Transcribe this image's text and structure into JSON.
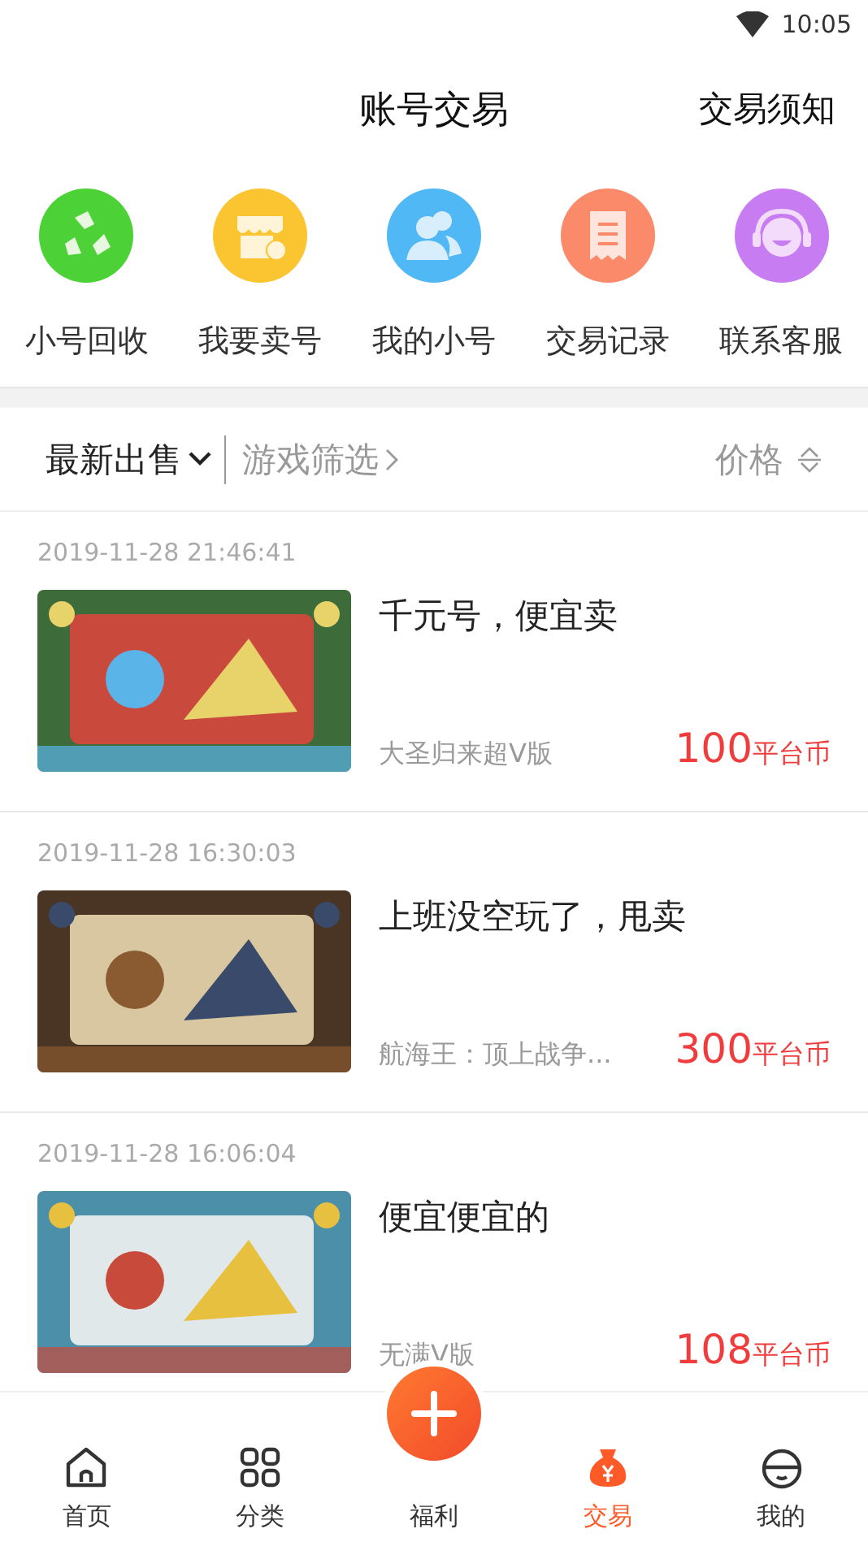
{
  "status_bar": {
    "time": "10:05"
  },
  "header": {
    "title": "账号交易",
    "action": "交易须知"
  },
  "shortcuts": [
    {
      "label": "小号回收",
      "kind": "recycle",
      "color": "#4cd137"
    },
    {
      "label": "我要卖号",
      "kind": "shop",
      "color": "#fbc531"
    },
    {
      "label": "我的小号",
      "kind": "users",
      "color": "#4fb8f5"
    },
    {
      "label": "交易记录",
      "kind": "receipt",
      "color": "#fb8a6a"
    },
    {
      "label": "联系客服",
      "kind": "service",
      "color": "#c77cf2"
    }
  ],
  "filters": {
    "sort": "最新出售",
    "game_filter": "游戏筛选",
    "price": "价格"
  },
  "listings": [
    {
      "time": "2019-11-28 21:46:41",
      "title": "千元号，便宜卖",
      "game": "大圣归来超V版",
      "price": "100",
      "unit": "平台币"
    },
    {
      "time": "2019-11-28 16:30:03",
      "title": "上班没空玩了，甩卖",
      "game": "航海王：顶上战争...",
      "price": "300",
      "unit": "平台币"
    },
    {
      "time": "2019-11-28 16:06:04",
      "title": "便宜便宜的",
      "game": "无满V版",
      "price": "108",
      "unit": "平台币"
    }
  ],
  "nav": [
    {
      "label": "首页",
      "kind": "home",
      "selected": false
    },
    {
      "label": "分类",
      "kind": "grid",
      "selected": false
    },
    {
      "label": "福利",
      "kind": "plus",
      "selected": false
    },
    {
      "label": "交易",
      "kind": "bag",
      "selected": true
    },
    {
      "label": "我的",
      "kind": "face",
      "selected": false
    }
  ]
}
